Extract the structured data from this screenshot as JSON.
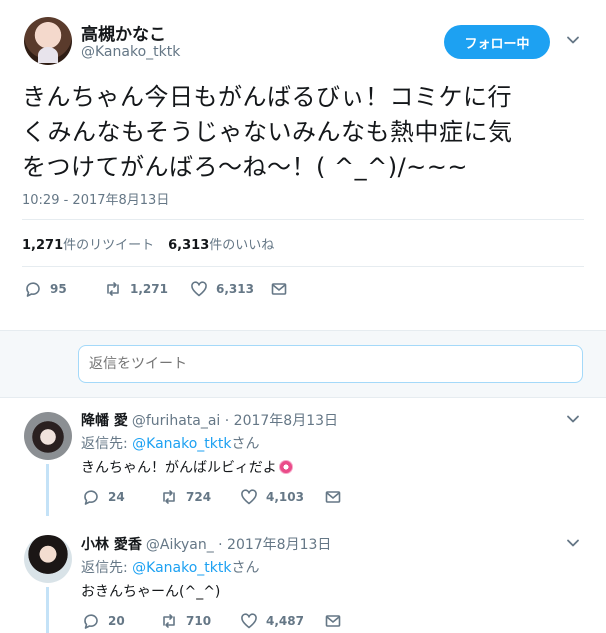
{
  "tweet": {
    "display_name": "高槻かなこ",
    "handle": "@Kanako_tktk",
    "follow_label": "フォロー中",
    "text_line1": "きんちゃん今日もがんばるびぃ！コミケに行",
    "text_line2": "くみんなもそうじゃないみんなも熱中症に気",
    "text_line3": "をつけてがんばろ〜ね〜！( ^_^)/~~~",
    "timestamp": "10:29 - 2017年8月13日",
    "retweets_count": "1,271",
    "retweets_label": "件のリツイート",
    "likes_count": "6,313",
    "likes_label": "件のいいね",
    "actions": {
      "replies": "95",
      "retweets": "1,271",
      "likes": "6,313"
    }
  },
  "reply_box": {
    "placeholder": "返信をツイート"
  },
  "replies": [
    {
      "display_name": "降幡 愛",
      "handle_date": "@furihata_ai · 2017年8月13日",
      "reply_to_prefix": "返信先: ",
      "reply_to_handle": "@Kanako_tktk",
      "reply_to_suffix": "さん",
      "text": "きんちゃん！がんばルビィだよ",
      "actions": {
        "replies": "24",
        "retweets": "724",
        "likes": "4,103"
      }
    },
    {
      "display_name": "小林 愛香",
      "handle_date": "@Aikyan_ · 2017年8月13日",
      "reply_to_prefix": "返信先: ",
      "reply_to_handle": "@Kanako_tktk",
      "reply_to_suffix": "さん",
      "text": "おきんちゃーん(^_^)",
      "actions": {
        "replies": "20",
        "retweets": "710",
        "likes": "4,487"
      }
    }
  ],
  "colors": {
    "accent": "#1da1f2",
    "text": "#14171a",
    "muted": "#657786",
    "divider": "#e6ecf0"
  }
}
